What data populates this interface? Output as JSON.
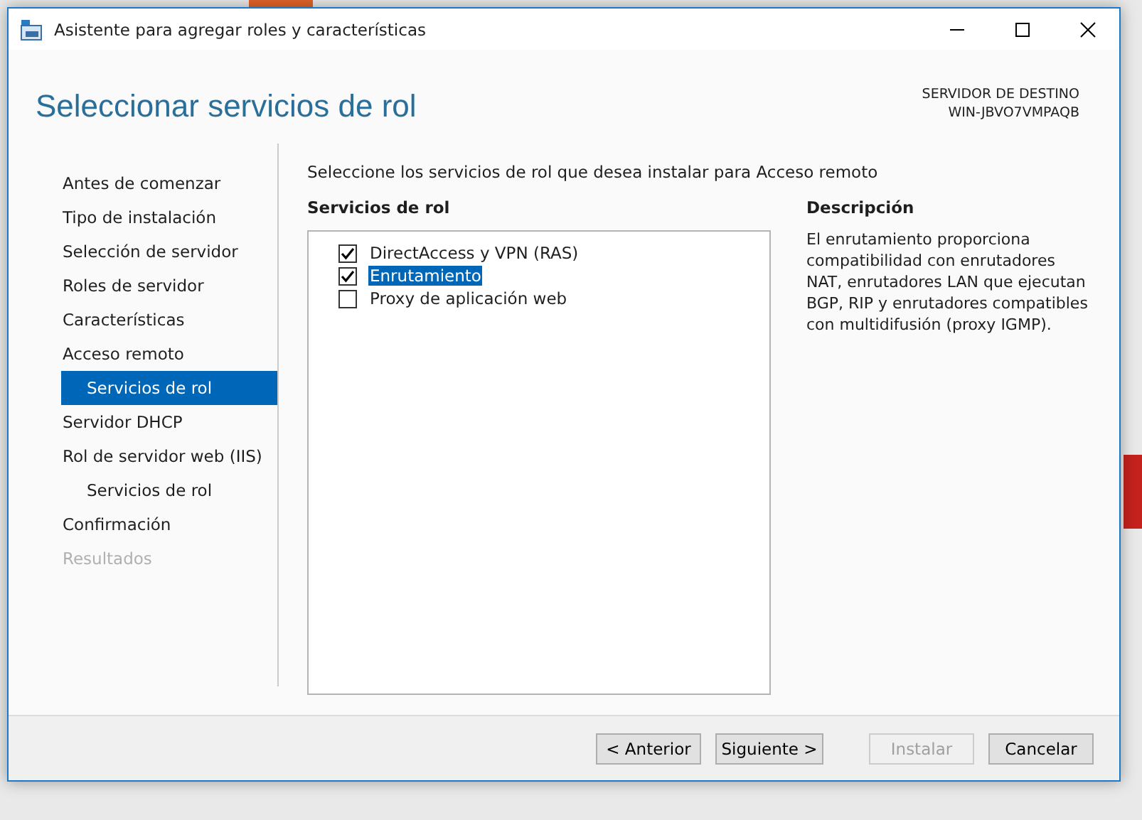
{
  "window": {
    "title": "Asistente para agregar roles y características"
  },
  "header": {
    "title": "Seleccionar servicios de rol",
    "destination_label": "SERVIDOR DE DESTINO",
    "destination_server": "WIN-JBVO7VMPAQB"
  },
  "sidebar": {
    "items": [
      {
        "label": "Antes de comenzar",
        "selected": false,
        "disabled": false
      },
      {
        "label": "Tipo de instalación",
        "selected": false,
        "disabled": false
      },
      {
        "label": "Selección de servidor",
        "selected": false,
        "disabled": false
      },
      {
        "label": "Roles de servidor",
        "selected": false,
        "disabled": false
      },
      {
        "label": "Características",
        "selected": false,
        "disabled": false
      },
      {
        "label": "Acceso remoto",
        "selected": false,
        "disabled": false,
        "children": [
          {
            "label": "Servicios de rol",
            "selected": true,
            "disabled": false
          }
        ]
      },
      {
        "label": "Servidor DHCP",
        "selected": false,
        "disabled": false
      },
      {
        "label": "Rol de servidor web (IIS)",
        "selected": false,
        "disabled": false,
        "children": [
          {
            "label": "Servicios de rol",
            "selected": false,
            "disabled": false
          }
        ]
      },
      {
        "label": "Confirmación",
        "selected": false,
        "disabled": false
      },
      {
        "label": "Resultados",
        "selected": false,
        "disabled": true
      }
    ]
  },
  "content": {
    "instruction": "Seleccione los servicios de rol que desea instalar para Acceso remoto",
    "list_heading": "Servicios de rol",
    "services": [
      {
        "label": "DirectAccess y VPN (RAS)",
        "checked": true,
        "selected": false
      },
      {
        "label": "Enrutamiento",
        "checked": true,
        "selected": true
      },
      {
        "label": "Proxy de aplicación web",
        "checked": false,
        "selected": false
      }
    ],
    "description_heading": "Descripción",
    "description": "El enrutamiento proporciona compatibilidad con enrutadores NAT, enrutadores LAN que ejecutan BGP, RIP y enrutadores compatibles con multidifusión (proxy IGMP)."
  },
  "buttons": [
    {
      "label": "< Anterior",
      "disabled": false
    },
    {
      "label": "Siguiente >",
      "disabled": false
    },
    {
      "label": "Instalar",
      "disabled": true
    },
    {
      "label": "Cancelar",
      "disabled": false
    }
  ]
}
